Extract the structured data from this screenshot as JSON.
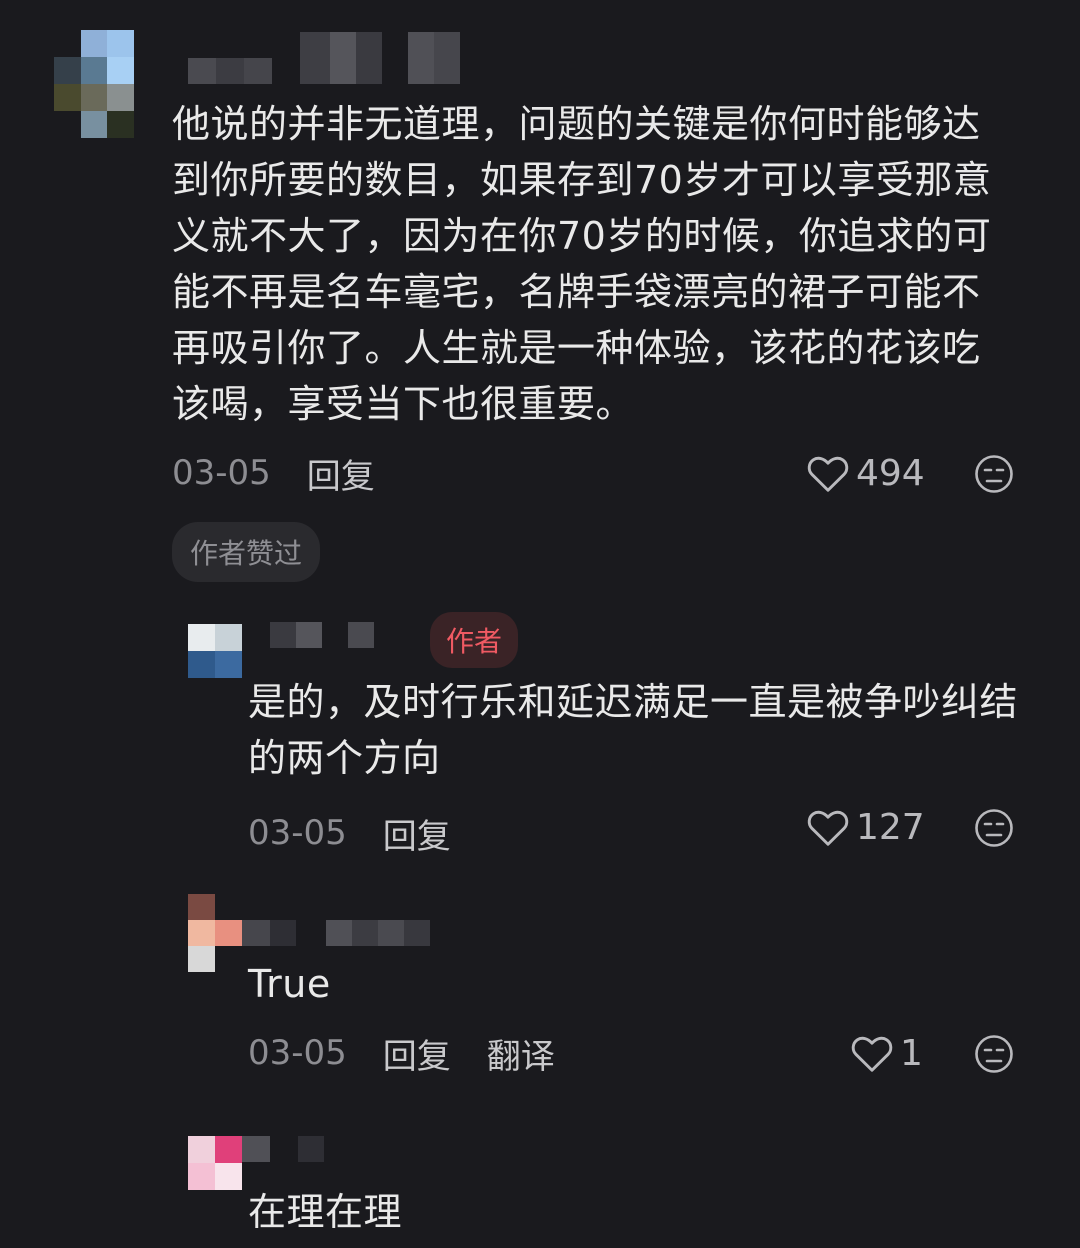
{
  "comments": [
    {
      "text": "他说的并非无道理，问题的关键是你何时能够达到你所要的数目，如果存到70岁才可以享受那意义就不大了，因为在你70岁的时候，你追求的可能不再是名车毫宅，名牌手袋漂亮的裙子可能不再吸引你了。人生就是一种体验，该花的花该吃该喝，享受当下也很重要。",
      "date": "03-05",
      "reply_label": "回复",
      "likes": "494",
      "author_liked_label": "作者赞过"
    },
    {
      "author_tag": "作者",
      "text": "是的，及时行乐和延迟满足一直是被争吵纠结的两个方向",
      "date": "03-05",
      "reply_label": "回复",
      "likes": "127"
    },
    {
      "text": "True",
      "date": "03-05",
      "reply_label": "回复",
      "translate_label": "翻译",
      "likes": "1"
    },
    {
      "text": "在理在理"
    }
  ],
  "icons": {
    "like": "heart-outline-icon",
    "dislike": "unhappy-face-icon"
  },
  "colors": {
    "background": "#1a1a1e",
    "author_tag_text": "#f05a63",
    "author_tag_bg": "#3a2326"
  }
}
